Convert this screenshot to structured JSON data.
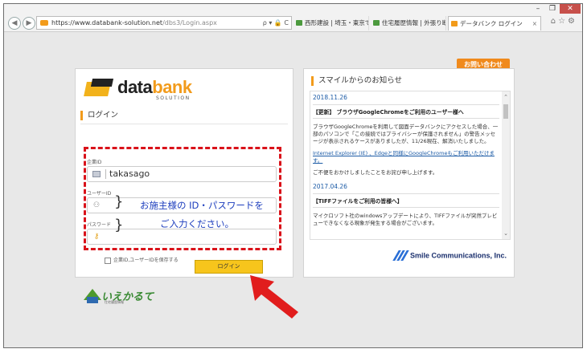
{
  "browser": {
    "window_controls": [
      "–",
      "❐",
      "✕"
    ],
    "url_domain": "https://www.databank-solution.net",
    "url_path": "/dbs3/Login.aspx",
    "address_controls": "ρ ▾ 🔒 C",
    "tabs": [
      {
        "label": "西形建設 | 埼玉・東京で自..."
      },
      {
        "label": "住宅履歴情報 | 外張り断..."
      },
      {
        "label": "データバンク ログイン",
        "active": true
      }
    ],
    "tab_close": "×",
    "tool_icons": "⌂☆⚙"
  },
  "page": {
    "contact_button": "お問い合わせ",
    "logo": {
      "text_data": "data",
      "text_bank": "bank",
      "sub": "SOLUTION"
    },
    "login": {
      "title": "ログイン",
      "company_id_label": "企業ID",
      "company_id_value": "takasago",
      "user_id_label": "ユーザーID",
      "password_label": "パスワード",
      "remember_label": "企業ID,ユーザーIDを保存する",
      "login_button": "ログイン"
    },
    "annotation": {
      "line1": "お施主様の ID・パスワードを",
      "line2": "ご入力ください。",
      "color": "#1c3dbd",
      "box_color": "#d9121a"
    },
    "footer_logo": {
      "text": "いえかるて",
      "sub": "住宅履歴情報"
    },
    "news": {
      "title": "スマイルからのお知らせ",
      "items": [
        {
          "date": "2018.11.26",
          "heading": "【更新】 ブラウザGoogleChromeをご利用のユーザー様へ",
          "body": "ブラウザGoogleChromeを利用して図面データバンクにアクセスした場合、一部のパソコンで「この接続ではプライバシーが保護されません」の警告メッセージが表示されるケースがありましたが、11/26現在、解消いたしました。",
          "link": "Internet Explorer (IE) 、Edgeと同様にGoogleChromeもご利用いただけます。",
          "footer": "ご不便をおかけしましたことをお詫び申し上げます。"
        },
        {
          "date": "2017.04.26",
          "heading": "【TIFFファイルをご利用の皆様へ】",
          "body": "マイクロソフト社のwindowsアップデートにより、TIFFファイルが突然プレビューできなくなる現象が発生する場合がございます。"
        }
      ]
    },
    "company": "Smile Communications, Inc."
  }
}
